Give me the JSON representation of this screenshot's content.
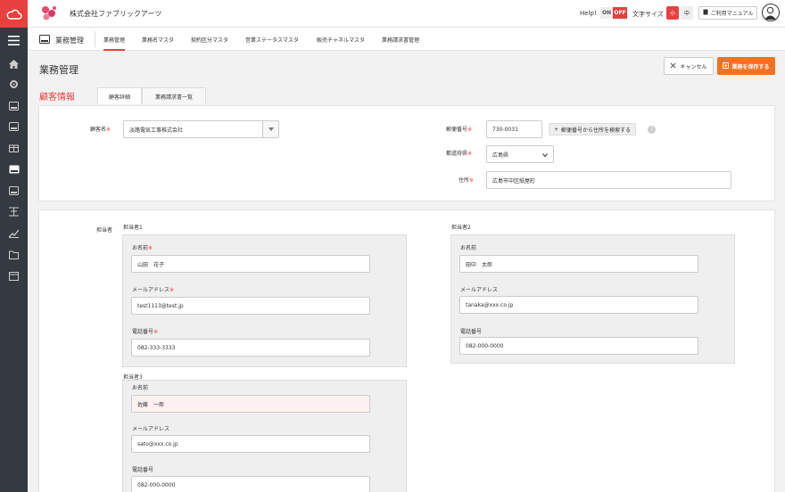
{
  "header": {
    "company": "株式会社ファブリックアーツ",
    "help_label": "Help!",
    "toggle_on": "ON",
    "toggle_off": "OFF",
    "font_size_label": "文字サイズ",
    "font_small": "小",
    "font_medium": "中",
    "manual_label": "ご利用マニュアル"
  },
  "subnav": {
    "title": "業務管理",
    "tabs": [
      {
        "label": "業務管理"
      },
      {
        "label": "業務名マスタ"
      },
      {
        "label": "契約区分マスタ"
      },
      {
        "label": "営業ステータスマスタ"
      },
      {
        "label": "販売チャネルマスタ"
      },
      {
        "label": "業務請求書管理"
      }
    ]
  },
  "page": {
    "title": "業務管理",
    "cancel_label": "キャンセル",
    "save_label": "業務を保存する",
    "section_title": "顧客情報",
    "inner_tabs": [
      {
        "label": "顧客詳細"
      },
      {
        "label": "業務請求書一覧"
      }
    ]
  },
  "customer": {
    "name_label": "顧客名",
    "name_value": "淡路電気工事株式会社",
    "zip_label": "郵便番号",
    "zip_value": "730-0031",
    "zip_search_label": "郵便番号から住所を検索する",
    "pref_label": "都道府県",
    "pref_value": "広島県",
    "address_label": "住所",
    "address_value": "広島市中区紙屋町",
    "required_mark": "※"
  },
  "contacts": {
    "section_label": "担当者",
    "name_label": "お名前",
    "email_label": "メールアドレス",
    "phone_label": "電話番号",
    "list": [
      {
        "heading": "担当者1",
        "name": "山田　花子",
        "email": "test1113@test.jp",
        "phone": "082-333-3333"
      },
      {
        "heading": "担当者2",
        "name": "田中　太郎",
        "email": "tanaka@xxx.co.jp",
        "phone": "082-000-0000"
      },
      {
        "heading": "担当者3",
        "name": "佐藤　一郎",
        "email": "sato@xxx.co.jp",
        "phone": "082-000-0000"
      }
    ]
  },
  "colors": {
    "accent": "#e8403f",
    "save": "#f4711f",
    "sidebar": "#343a40"
  }
}
